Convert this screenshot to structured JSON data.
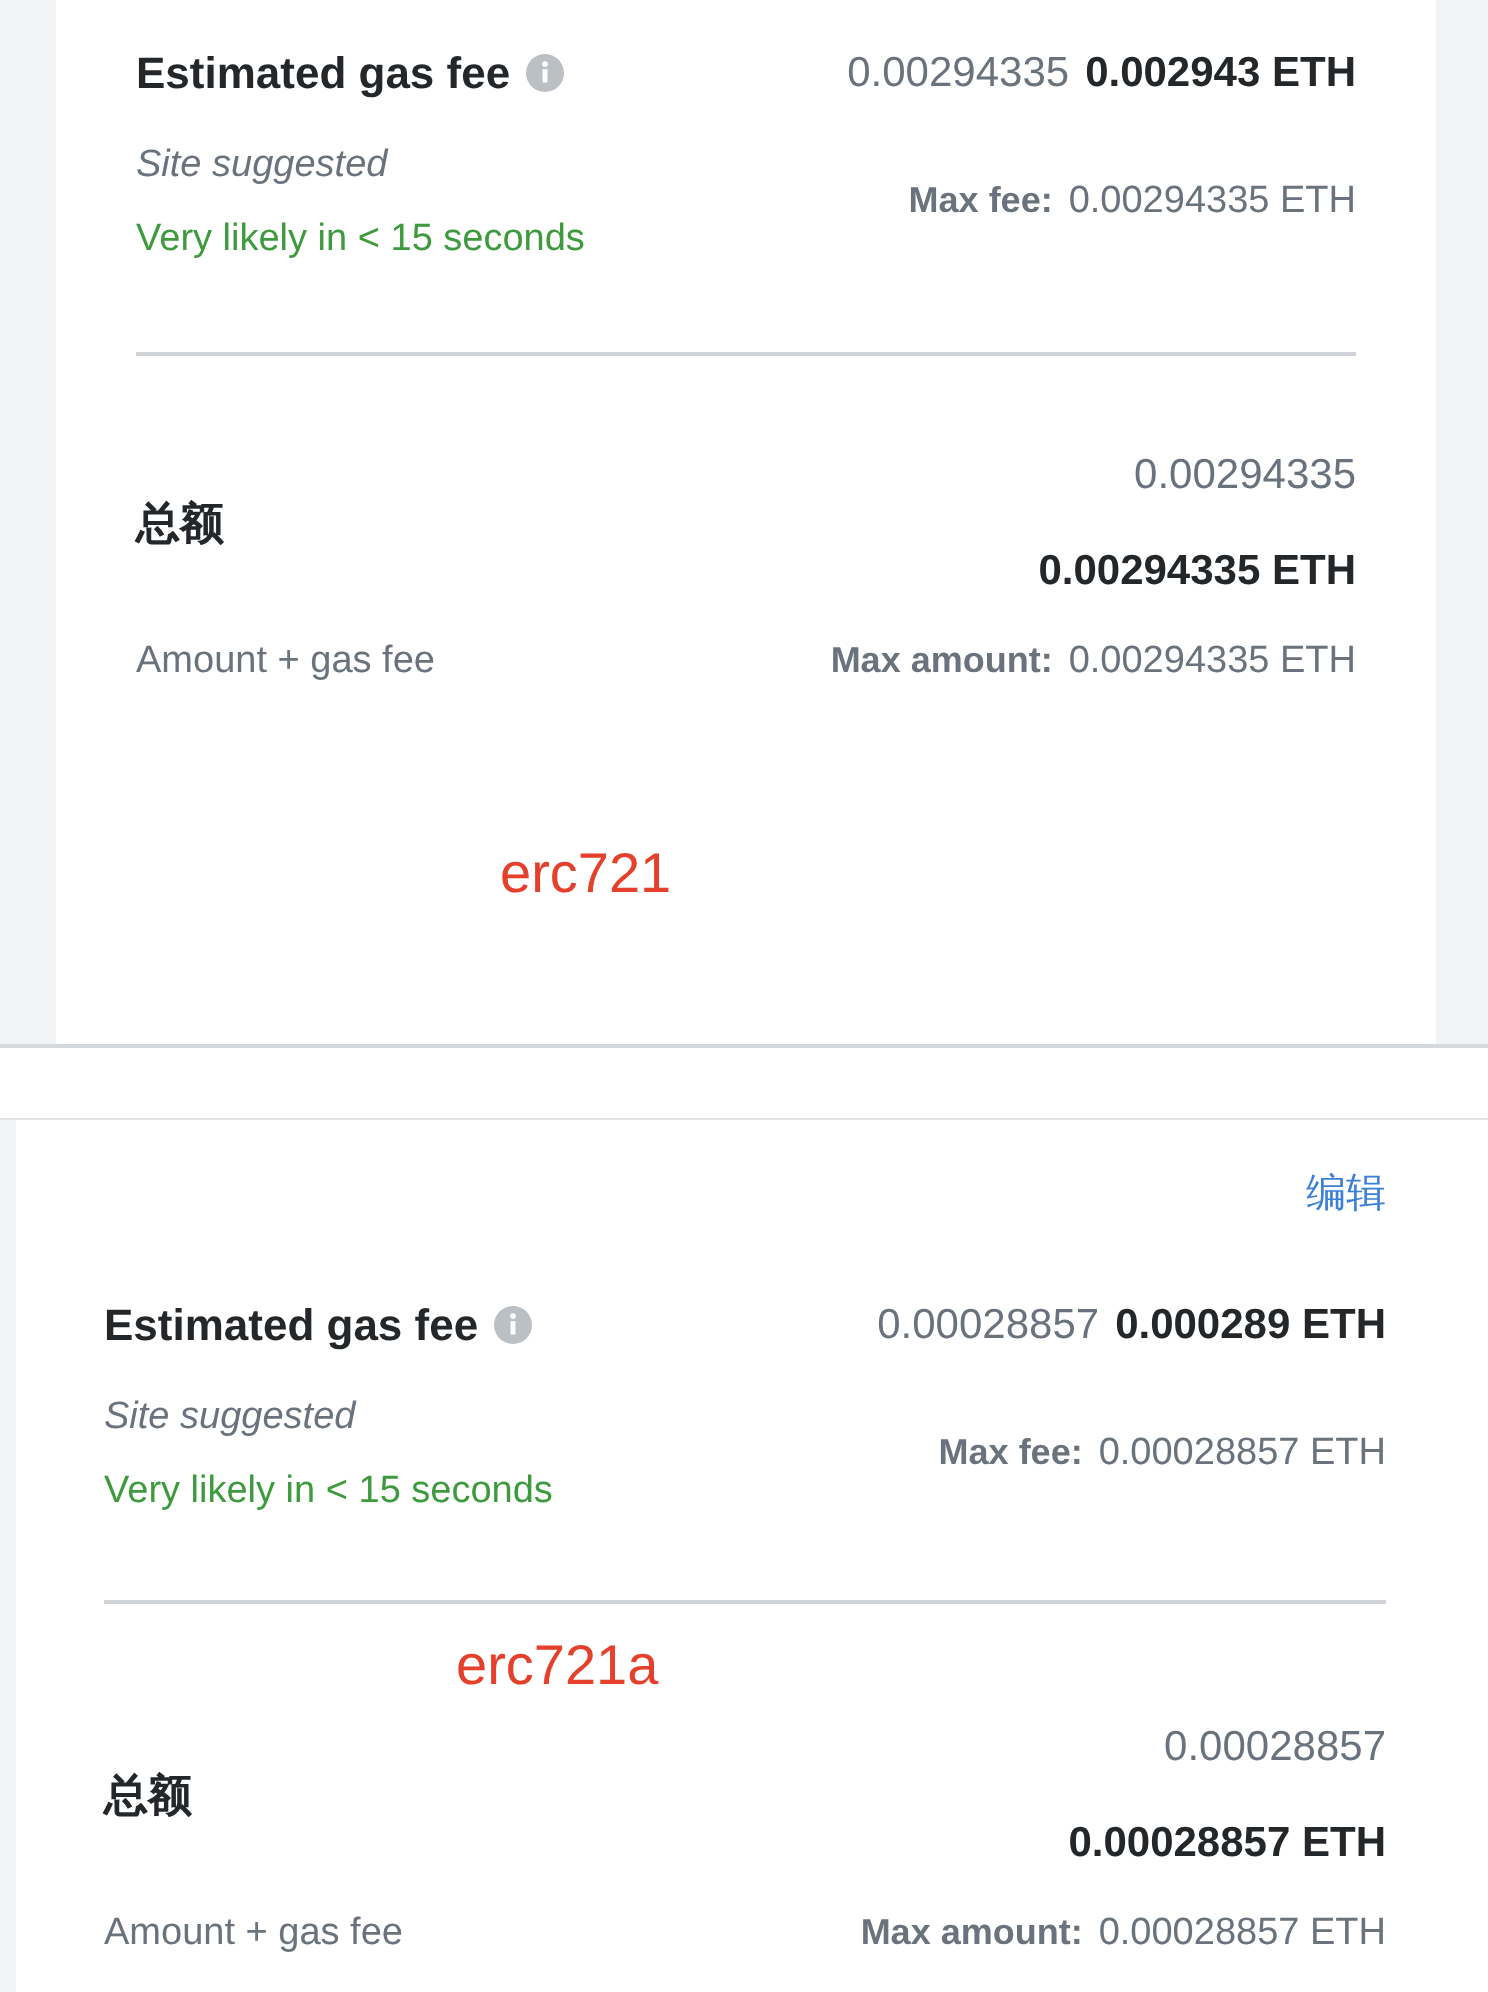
{
  "panels": [
    {
      "sections": [
        {
          "kind": "fee",
          "title": "Estimated gas fee",
          "value": "0.00294335",
          "value_bold": "0.002943 ETH",
          "source": "Site suggested",
          "timing": "Very likely in < 15 seconds",
          "max_label": "Max fee:",
          "max_value": "0.00294335 ETH"
        },
        {
          "kind": "total",
          "title": "总额",
          "value": "0.00294335",
          "value_bold": "0.00294335 ETH",
          "subtitle": "Amount + gas fee",
          "max_label": "Max amount:",
          "max_value": "0.00294335 ETH"
        },
        {
          "kind": "annotation",
          "text": "erc721"
        }
      ]
    },
    {
      "sections": [
        {
          "kind": "edit",
          "text": "编辑"
        },
        {
          "kind": "fee",
          "title": "Estimated gas fee",
          "value": "0.00028857",
          "value_bold": "0.000289 ETH",
          "source": "Site suggested",
          "timing": "Very likely in < 15 seconds",
          "max_label": "Max fee:",
          "max_value": "0.00028857 ETH"
        },
        {
          "kind": "annotation",
          "text": "erc721a"
        },
        {
          "kind": "total",
          "title": "总额",
          "value": "0.00028857",
          "value_bold": "0.00028857 ETH",
          "subtitle": "Amount + gas fee",
          "max_label": "Max amount:",
          "max_value": "0.00028857 ETH"
        }
      ]
    }
  ]
}
